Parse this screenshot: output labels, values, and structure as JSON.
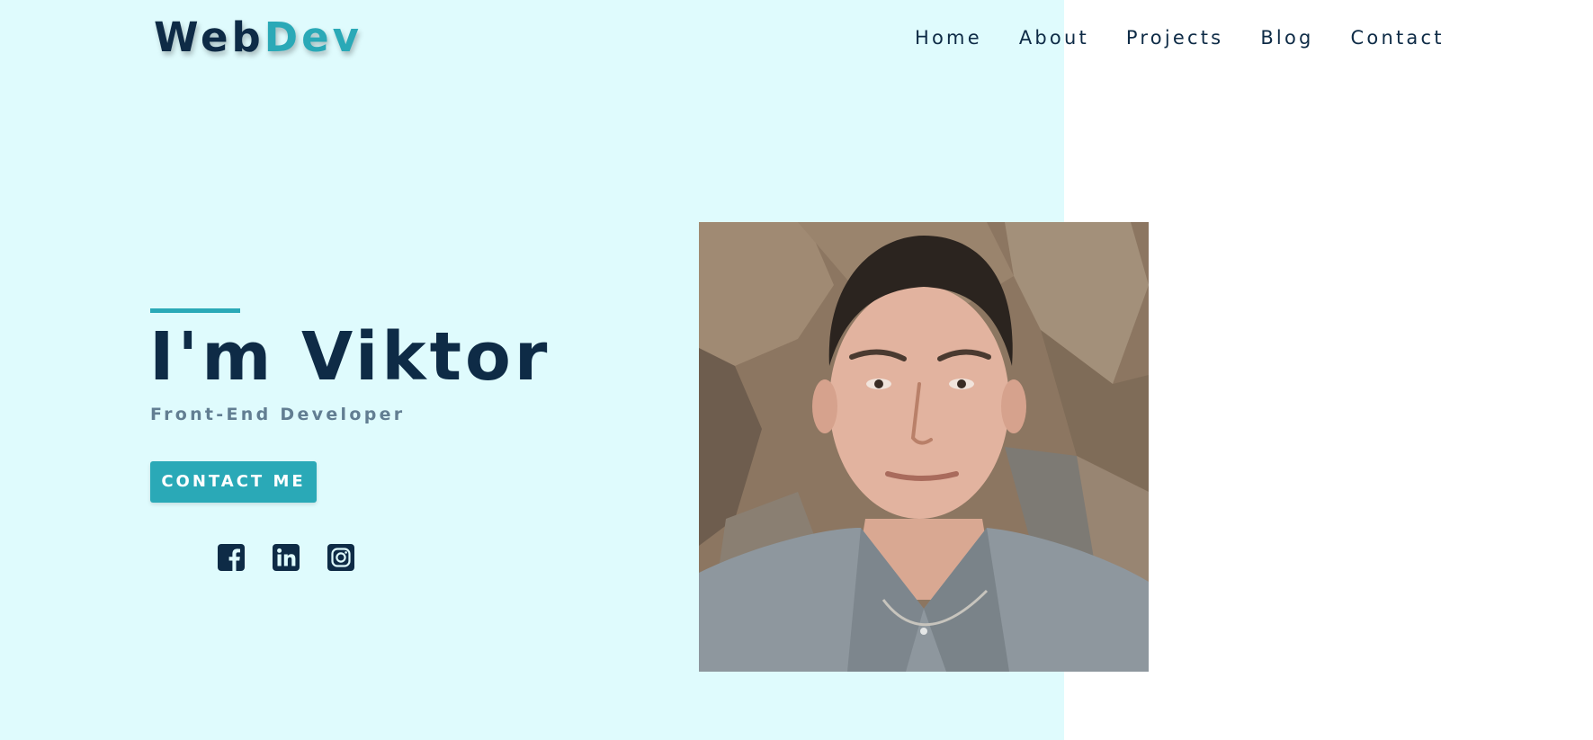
{
  "brand": {
    "logo_part1": "Web",
    "logo_part2": "Dev"
  },
  "nav": {
    "items": [
      {
        "label": "Home"
      },
      {
        "label": "About"
      },
      {
        "label": "Projects"
      },
      {
        "label": "Blog"
      },
      {
        "label": "Contact"
      }
    ]
  },
  "hero": {
    "title": "I'm Viktor",
    "subtitle": "Front-End Developer",
    "cta_label": "CONTACT ME",
    "socials": [
      {
        "icon": "facebook-icon"
      },
      {
        "icon": "linkedin-icon"
      },
      {
        "icon": "instagram-icon"
      }
    ],
    "portrait_alt": "portrait-photo"
  },
  "colors": {
    "dark_navy": "#0e2b46",
    "teal_accent": "#2aa9b7",
    "hero_background": "#dffbfd",
    "subtitle_gray": "#627e92",
    "page_background": "#ffffff"
  }
}
